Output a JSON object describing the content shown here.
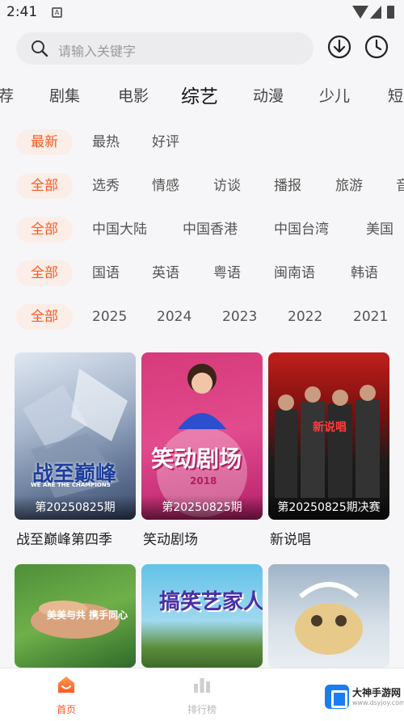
{
  "status_bar": {
    "time": "2:41",
    "notification_glyph": "A"
  },
  "search": {
    "placeholder": "请输入关键字"
  },
  "categories": [
    {
      "label": "荐"
    },
    {
      "label": "剧集"
    },
    {
      "label": "电影"
    },
    {
      "label": "综艺",
      "active": true
    },
    {
      "label": "动漫"
    },
    {
      "label": "少儿"
    },
    {
      "label": "短"
    }
  ],
  "filters": {
    "sort": [
      "最新",
      "最热",
      "好评"
    ],
    "type": [
      "全部",
      "选秀",
      "情感",
      "访谈",
      "播报",
      "旅游",
      "音"
    ],
    "region": [
      "全部",
      "中国大陆",
      "中国香港",
      "中国台湾",
      "美国"
    ],
    "lang": [
      "全部",
      "国语",
      "英语",
      "粤语",
      "闽南语",
      "韩语"
    ],
    "year": [
      "全部",
      "2025",
      "2024",
      "2023",
      "2022",
      "2021"
    ]
  },
  "cards": [
    {
      "title": "战至巅峰第四季",
      "episode": "第20250825期",
      "poster_text": "战至巅峰",
      "poster_sub": "WE ARE THE CHAMPIONS"
    },
    {
      "title": "笑动剧场",
      "episode": "第20250825期",
      "poster_text": "笑动剧场",
      "poster_sub": "2018"
    },
    {
      "title": "新说唱",
      "episode": "第20250825期决赛",
      "poster_text": "新说唱"
    },
    {
      "title": "",
      "episode": "",
      "poster_text": "美美与共 携手同心"
    },
    {
      "title": "",
      "episode": "",
      "poster_text": "搞笑艺家人"
    },
    {
      "title": "",
      "episode": "",
      "poster_text": ""
    }
  ],
  "bottom_nav": {
    "home": "首页",
    "rank": "排行榜"
  },
  "watermark": {
    "name": "大神手游网",
    "url": "www.dsyjoy.com"
  },
  "colors": {
    "accent": "#ff5a1f",
    "chip_bg": "#fbeee9"
  }
}
